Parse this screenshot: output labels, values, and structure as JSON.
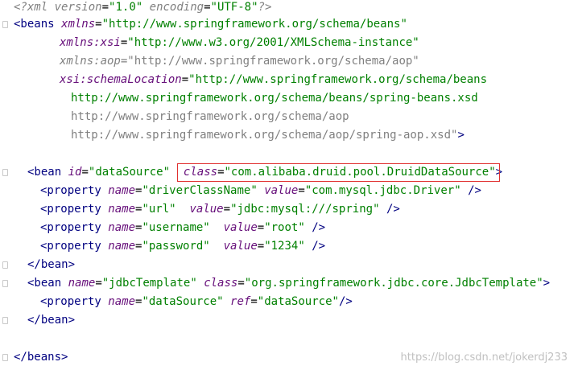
{
  "code": {
    "line1": {
      "open": "<?",
      "name": "xml",
      "version_attr": "version",
      "version_val": "\"1.0\"",
      "encoding_attr": "encoding",
      "encoding_val": "\"UTF-8\"",
      "close": "?>"
    },
    "beans_open": {
      "tag": "<beans",
      "xmlns_attr": "xmlns",
      "xmlns_val": "\"http://www.springframework.org/schema/beans\"",
      "xsi_attr": "xmlns:xsi",
      "xsi_val": "\"http://www.w3.org/2001/XMLSchema-instance\"",
      "aop_attr": "xmlns:aop",
      "aop_val": "\"http://www.springframework.org/schema/aop\"",
      "schema_attr": "xsi:schemaLocation",
      "schema_val1": "\"http://www.springframework.org/schema/beans",
      "schema_val2": "http://www.springframework.org/schema/beans/spring-beans.xsd",
      "schema_val3": "http://www.springframework.org/schema/aop",
      "schema_val4": "http://www.springframework.org/schema/aop/spring-aop.xsd\"",
      "tag_close": ">"
    },
    "bean1": {
      "tag": "<bean",
      "id_attr": "id",
      "id_val": "\"dataSource\"",
      "class_attr": "class",
      "class_val": "\"com.alibaba.druid.pool.DruidDataSource\"",
      "tag_close": ">",
      "properties": [
        {
          "tag": "<property",
          "name_attr": "name",
          "name_val": "\"driverClassName\"",
          "value_attr": "value",
          "value_val": "\"com.mysql.jdbc.Driver\"",
          "close": "/>"
        },
        {
          "tag": "<property",
          "name_attr": "name",
          "name_val": "\"url\"",
          "value_attr": "value",
          "value_val": "\"jdbc:mysql:///spring\"",
          "close": "/>"
        },
        {
          "tag": "<property",
          "name_attr": "name",
          "name_val": "\"username\"",
          "value_attr": "value",
          "value_val": "\"root\"",
          "close": "/>"
        },
        {
          "tag": "<property",
          "name_attr": "name",
          "name_val": "\"password\"",
          "value_attr": "value",
          "value_val": "\"1234\"",
          "close": "/>"
        }
      ],
      "end": "</bean>"
    },
    "bean2": {
      "tag": "<bean",
      "name_attr": "name",
      "name_val": "\"jdbcTemplate\"",
      "class_attr": "class",
      "class_val": "\"org.springframework.jdbc.core.JdbcTemplate\"",
      "tag_close": ">",
      "property": {
        "tag": "<property",
        "name_attr": "name",
        "name_val": "\"dataSource\"",
        "ref_attr": "ref",
        "ref_val": "\"dataSource\"",
        "close": "/>"
      },
      "end": "</bean>"
    },
    "beans_close": "</beans>"
  },
  "watermark": "https://blog.csdn.net/jokerdj233",
  "colors": {
    "tag": "#000080",
    "attribute": "#0000ff",
    "value": "#008000",
    "highlight_border": "#e03030"
  }
}
